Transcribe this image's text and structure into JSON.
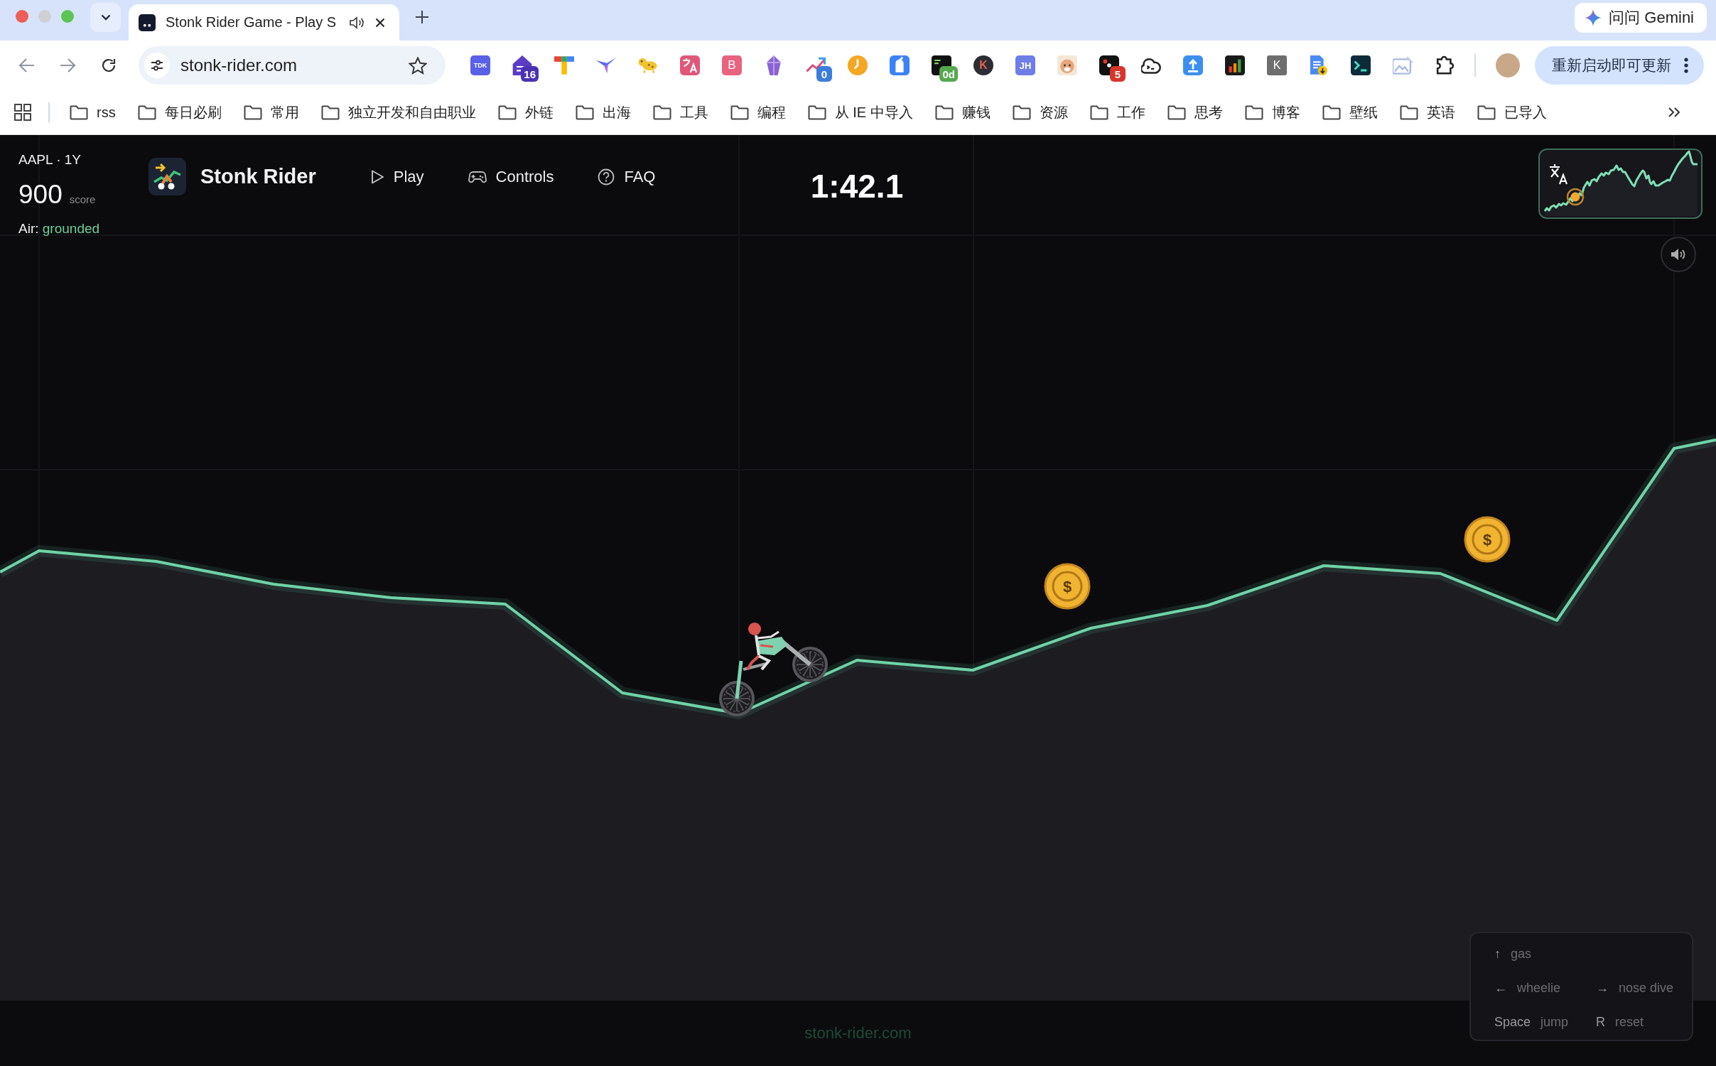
{
  "browser": {
    "tabs": [
      {
        "title": "Stonk Rider Game - Play S",
        "selected": true
      }
    ],
    "gemini_button": "问问 Gemini",
    "address": "stonk-rider.com",
    "extensions": [
      {
        "kind": "letter",
        "label": "TDK"
      },
      {
        "kind": "icon",
        "badge": {
          "text": "16",
          "color": "#4b32b4"
        }
      },
      {
        "kind": "icon"
      },
      {
        "kind": "icon"
      },
      {
        "kind": "icon"
      },
      {
        "kind": "icon"
      },
      {
        "kind": "letter",
        "label": "B"
      },
      {
        "kind": "icon"
      },
      {
        "kind": "icon",
        "badge": {
          "text": "0",
          "color": "#3b7ddd"
        }
      },
      {
        "kind": "icon"
      },
      {
        "kind": "icon"
      },
      {
        "kind": "icon",
        "badge": {
          "text": "0d",
          "color": "#55a84f"
        }
      },
      {
        "kind": "letter",
        "label": "K"
      },
      {
        "kind": "letter",
        "label": "JH"
      },
      {
        "kind": "icon"
      },
      {
        "kind": "icon",
        "badge": {
          "text": "5",
          "color": "#d7352b"
        }
      },
      {
        "kind": "icon"
      },
      {
        "kind": "icon"
      },
      {
        "kind": "icon"
      },
      {
        "kind": "letter",
        "label": "K"
      },
      {
        "kind": "icon"
      },
      {
        "kind": "icon"
      },
      {
        "kind": "icon"
      },
      {
        "kind": "icon"
      }
    ],
    "update_button": "重新启动即可更新",
    "bookmarks": [
      "rss",
      "每日必刷",
      "常用",
      "独立开发和自由职业",
      "外链",
      "出海",
      "工具",
      "编程",
      "从 IE 中导入",
      "赚钱",
      "资源",
      "工作",
      "思考",
      "博客",
      "壁纸",
      "英语",
      "已导入"
    ]
  },
  "game": {
    "hud": {
      "ticker": "AAPL · 1Y",
      "score": "900",
      "score_label": "score",
      "air_label": "Air:",
      "air_value": "grounded"
    },
    "brand": "Stonk Rider",
    "nav": [
      {
        "label": "Play"
      },
      {
        "label": "Controls"
      },
      {
        "label": "FAQ"
      }
    ],
    "timer": "1:42.1",
    "coins": [
      {
        "symbol": "$"
      },
      {
        "symbol": "$"
      }
    ],
    "controls_help": [
      [
        {
          "key": "↑",
          "action": "gas"
        }
      ],
      [
        {
          "key": "←",
          "action": "wheelie"
        },
        {
          "key": "→",
          "action": "nose dive"
        }
      ],
      [
        {
          "key": "Space",
          "action": "jump"
        },
        {
          "key": "R",
          "action": "reset"
        }
      ]
    ]
  },
  "footer": {
    "text": "stonk-rider.com"
  }
}
